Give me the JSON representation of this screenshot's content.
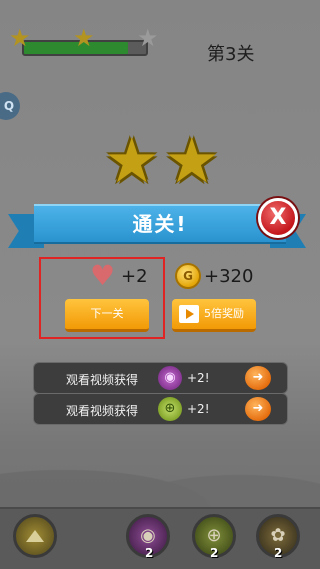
{
  "level": {
    "label": "第3关",
    "progress_fraction": 0.85,
    "stars_earned": 2,
    "stars_total": 3
  },
  "side_tab": {
    "label": "Q"
  },
  "result": {
    "earned_stars": 2,
    "title": "通关!",
    "close_symbol": "X"
  },
  "rewards": {
    "hearts": "+2",
    "coins": "+320",
    "coin_symbol": "G",
    "next_button": "下一关",
    "multiplier_button": "5倍奖励"
  },
  "video_offers": [
    {
      "label": "观看视频获得",
      "item_icon": "candy-icon",
      "bonus": "+2!"
    },
    {
      "label": "观看视频获得",
      "item_icon": "target-icon",
      "bonus": "+2!"
    }
  ],
  "boosters": [
    {
      "icon": "up-arrow-icon",
      "count": ""
    },
    {
      "icon": "candy-icon",
      "count": "2"
    },
    {
      "icon": "target-icon",
      "count": "2"
    },
    {
      "icon": "candy-mix-icon",
      "count": "2"
    }
  ],
  "colors": {
    "ribbon": "#2a93cf",
    "close": "#c3171d",
    "button": "#f29a06",
    "highlight_box": "#e02424"
  }
}
